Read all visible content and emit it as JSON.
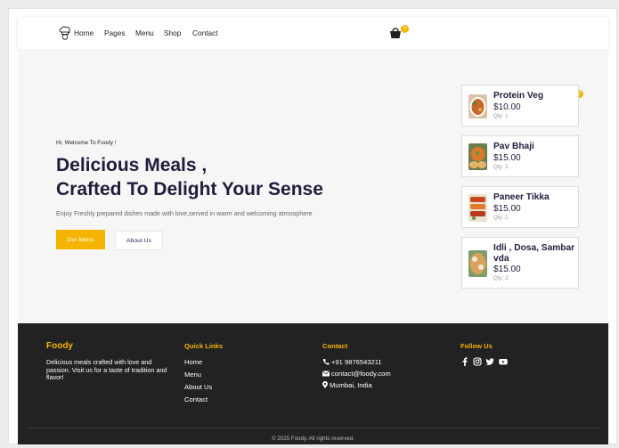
{
  "navbar": {
    "links": [
      "Home",
      "Pages",
      "Menu",
      "Shop",
      "Contact"
    ],
    "cart_count": "0"
  },
  "hero": {
    "greeting": "Hi, Welcome To Foody !",
    "title_line1": "Delicious Meals ,",
    "title_line2": "Crafted To Delight Your Sense",
    "subtitle": "Enjoy Freshly prepared dishes made with love,served in warm and welcoming atmosphere",
    "primary_button": "Our Menu",
    "secondary_button": "About Us"
  },
  "cart_panel": {
    "badge": "0",
    "items": [
      {
        "name": "Protein Veg",
        "price": "$10.00",
        "qty": "Qty: 1"
      },
      {
        "name": "Pav Bhaji",
        "price": "$15.00",
        "qty": "Qty: 2"
      },
      {
        "name": "Paneer Tikka",
        "price": "$15.00",
        "qty": "Qty: 2"
      },
      {
        "name": "Idli , Dosa, Sambar vda",
        "price": "$15.00",
        "qty": "Qty: 2"
      }
    ]
  },
  "footer": {
    "brand": "Foody",
    "description": "Delicious meals crafted with love and passion. Visit us for a taste of tradition and flavor!",
    "quick_links_heading": "Quick Links",
    "quick_links": [
      "Home",
      "Menu",
      "About Us",
      "Contact"
    ],
    "contact_heading": "Contact",
    "phone": "+91 9876543211",
    "email": "contact@foody.com",
    "location": "Mumbai, India",
    "follow_heading": "Follow Us",
    "social_icons": [
      "facebook-icon",
      "instagram-icon",
      "twitter-icon",
      "youtube-icon"
    ],
    "copyright": "© 2025 Foody. All rights reserved."
  },
  "colors": {
    "accent": "#f5b400",
    "title": "#1e1d3e",
    "footer_bg": "#222222",
    "hero_bg": "#f6f6f6"
  }
}
